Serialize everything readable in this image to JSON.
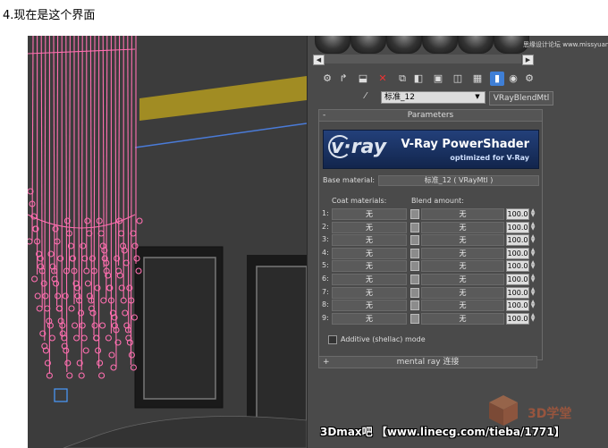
{
  "caption": "4.现在是这个界面",
  "material": {
    "name": "标准_12",
    "type_button": "VRayBlendMtl"
  },
  "rollout": {
    "collapse_sign": "-",
    "title": "Parameters"
  },
  "banner": {
    "logo": "v·ray",
    "title": "V-Ray PowerShader",
    "subtitle": "optimized for V-Ray"
  },
  "base_material": {
    "label": "Base material:",
    "value": "标准_12 ( VRayMtl )"
  },
  "headers": {
    "coat": "Coat materials:",
    "blend": "Blend amount:"
  },
  "rows": [
    {
      "num": "1:",
      "coat": "无",
      "blend": "无",
      "amount": "100.0"
    },
    {
      "num": "2:",
      "coat": "无",
      "blend": "无",
      "amount": "100.0"
    },
    {
      "num": "3:",
      "coat": "无",
      "blend": "无",
      "amount": "100.0"
    },
    {
      "num": "4:",
      "coat": "无",
      "blend": "无",
      "amount": "100.0"
    },
    {
      "num": "5:",
      "coat": "无",
      "blend": "无",
      "amount": "100.0"
    },
    {
      "num": "6:",
      "coat": "无",
      "blend": "无",
      "amount": "100.0"
    },
    {
      "num": "7:",
      "coat": "无",
      "blend": "无",
      "amount": "100.0"
    },
    {
      "num": "8:",
      "coat": "无",
      "blend": "无",
      "amount": "100.0"
    },
    {
      "num": "9:",
      "coat": "无",
      "blend": "无",
      "amount": "100.0"
    }
  ],
  "additive_label": "Additive (shellac) mode",
  "mental_ray": {
    "sign": "+",
    "title": "mental ray 连接"
  },
  "watermark": "3Dmax吧 【www.linecg.com/tieba/1771】",
  "top_watermark": "思缘设计论坛 www.missyuan.com",
  "corner_logo": "3D学堂",
  "colors": {
    "panel_bg": "#4a4a4a",
    "viewport_bg": "#3c3c3c",
    "chandelier": "#ff6fb0",
    "beam": "#b39a1e",
    "banner": "#1c3566"
  },
  "icons": [
    "get-material-icon",
    "put-material-icon",
    "assign-material-icon",
    "delete-icon",
    "copy-icon",
    "unique-icon",
    "material-id-icon",
    "show-map-icon",
    "show-end-result-icon",
    "go-parent-icon",
    "go-sibling-icon"
  ]
}
